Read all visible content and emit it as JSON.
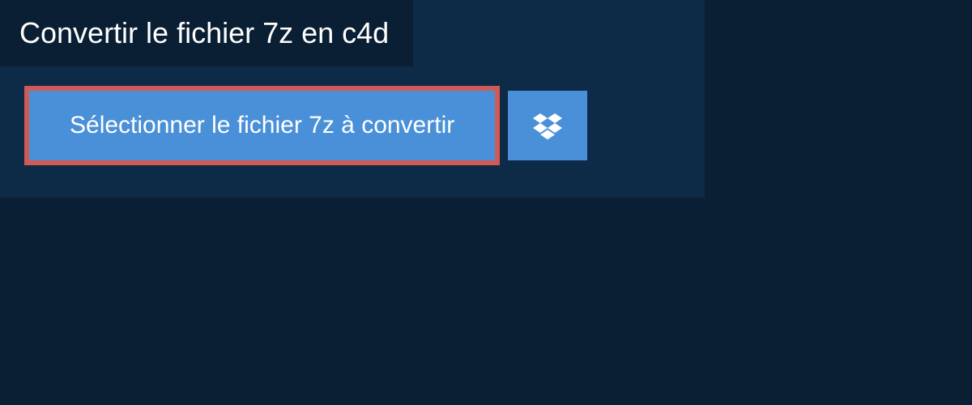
{
  "header": {
    "title": "Convertir le fichier 7z en c4d"
  },
  "actions": {
    "select_file_label": "Sélectionner le fichier 7z à convertir"
  }
}
